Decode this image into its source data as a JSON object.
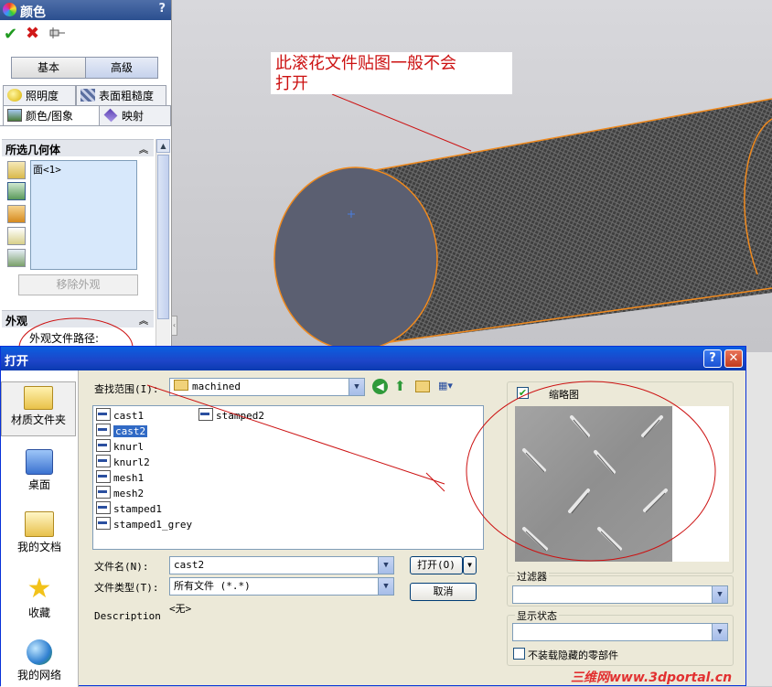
{
  "panel": {
    "title": "颜色",
    "help": "?",
    "mode_tabs": [
      "基本",
      "高级"
    ],
    "prop_tabs": [
      "照明度",
      "表面粗糙度",
      "颜色/图象",
      "映射"
    ],
    "geometry": {
      "header": "所选几何体",
      "items": [
        "面<1>"
      ],
      "remove_label": "移除外观"
    },
    "appearance": {
      "header": "外观",
      "path_label": "外观文件路径:"
    }
  },
  "annotation": {
    "text_line1": "此滚花文件贴图一般不会",
    "text_line2": "打开"
  },
  "dialog": {
    "title": "打开",
    "lookin_label": "查找范围(I):",
    "lookin_value": "machined",
    "places": [
      "材质文件夹",
      "桌面",
      "我的文档",
      "收藏",
      "我的网络"
    ],
    "files_col1": [
      "cast1",
      "cast2",
      "knurl",
      "knurl2",
      "mesh1",
      "mesh2",
      "stamped1",
      "stamped1_grey"
    ],
    "files_col2": [
      "stamped2"
    ],
    "selected_file": "cast2",
    "filename_label": "文件名(N):",
    "filename_value": "cast2",
    "filetype_label": "文件类型(T):",
    "filetype_value": "所有文件 (*.*)",
    "description_label": "Description",
    "description_value": "<无>",
    "open_button": "打开(O)",
    "cancel_button": "取消",
    "thumbnail_label": "缩略图",
    "filter_label": "过滤器",
    "display_state_label": "显示状态",
    "no_load_hidden_label": "不装载隐藏的零部件"
  },
  "watermark": "三维网www.3dportal.cn",
  "colors": {
    "accent_red": "#cc1111",
    "title_blue": "#0a5fe0",
    "edge_orange": "#f08a1e"
  }
}
